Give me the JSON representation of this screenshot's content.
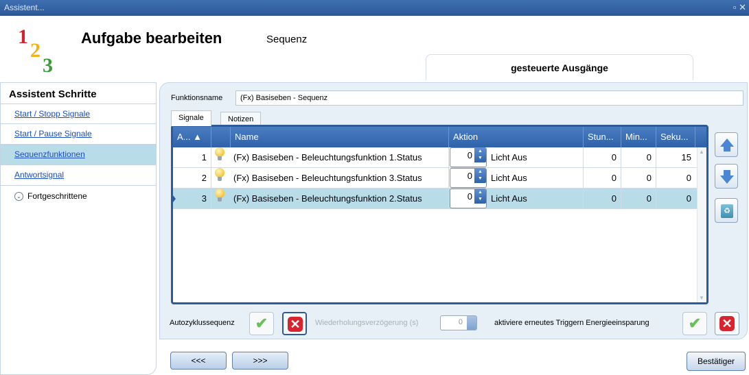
{
  "window": {
    "title": "Assistent...",
    "controls": "▫ ✕"
  },
  "header": {
    "logo_digits": [
      "1",
      "2",
      "3"
    ],
    "title": "Aufgabe bearbeiten",
    "subtitle": "Sequenz",
    "active_tab": "gesteuerte Ausgänge"
  },
  "sidebar": {
    "title": "Assistent Schritte",
    "items": [
      {
        "label": "Start / Stopp Signale"
      },
      {
        "label": "Start / Pause Signale"
      },
      {
        "label": "Sequenzfunktionen"
      },
      {
        "label": "Antwortsignal"
      }
    ],
    "advanced_label": "Fortgeschrittene"
  },
  "form": {
    "function_name_label": "Funktionsname",
    "function_name_value": "(Fx) Basiseben - Sequenz",
    "tabs": [
      {
        "label": "Signale"
      },
      {
        "label": "Notizen"
      }
    ]
  },
  "table": {
    "columns": [
      "A... ▲",
      "Name",
      "Aktion",
      "Stun...",
      "Min...",
      "Seku..."
    ],
    "rows": [
      {
        "index": "1",
        "name": "(Fx) Basiseben - Beleuchtungsfunktion 1.Status",
        "value": "0",
        "action": "Licht Aus",
        "hours": "0",
        "minutes": "0",
        "seconds": "15"
      },
      {
        "index": "2",
        "name": "(Fx) Basiseben - Beleuchtungsfunktion 3.Status",
        "value": "0",
        "action": "Licht Aus",
        "hours": "0",
        "minutes": "0",
        "seconds": "0"
      },
      {
        "index": "3",
        "name": "(Fx) Basiseben - Beleuchtungsfunktion 2.Status",
        "value": "0",
        "action": "Licht Aus",
        "hours": "0",
        "minutes": "0",
        "seconds": "0"
      }
    ]
  },
  "options": {
    "autocycle_label": "Autozyklussequenz",
    "repeat_delay_label": "Wiederholungsverzögerung (s)",
    "repeat_delay_value": "0",
    "retrigger_label": "aktiviere erneutes Triggern Energieeinsparung"
  },
  "nav": {
    "prev": "<<<",
    "next": ">>>",
    "confirm": "Bestätiger"
  }
}
